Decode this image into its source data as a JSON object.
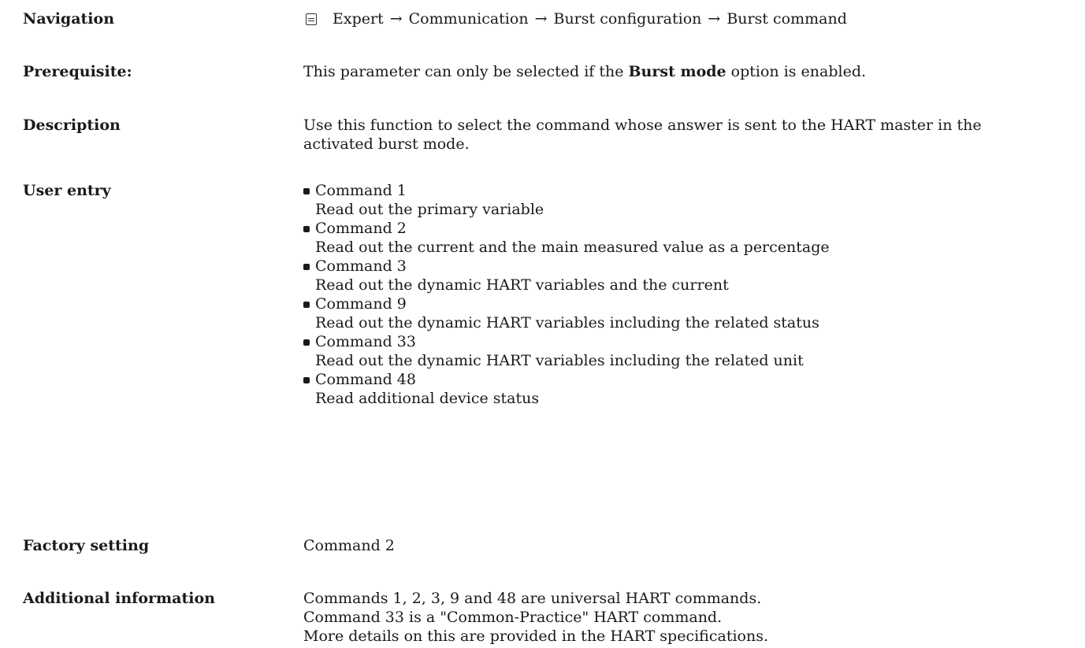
{
  "navigation": {
    "label": "Navigation",
    "icon": "menu-icon",
    "path": [
      "Expert",
      "Communication",
      "Burst configuration",
      "Burst command"
    ],
    "separator": "→"
  },
  "prerequisite": {
    "label": "Prerequisite:",
    "text_before": "This parameter can only be selected if the ",
    "bold": "Burst mode",
    "text_after": " option is enabled."
  },
  "description": {
    "label": "Description",
    "line1": "Use this function to select the command whose answer is sent to the HART master in the",
    "line2": "activated burst mode."
  },
  "user_entry": {
    "label": "User entry",
    "items": [
      {
        "name": "Command 1",
        "desc": "Read out the primary variable"
      },
      {
        "name": "Command 2",
        "desc": "Read out the current and the main measured value as a percentage"
      },
      {
        "name": "Command 3",
        "desc": "Read out the dynamic HART variables and the current"
      },
      {
        "name": "Command 9",
        "desc": "Read out the dynamic HART variables including the related status"
      },
      {
        "name": "Command 33",
        "desc": "Read out the dynamic HART variables including the related unit"
      },
      {
        "name": "Command 48",
        "desc": "Read additional device status"
      }
    ]
  },
  "factory_setting": {
    "label": "Factory setting",
    "value": "Command 2"
  },
  "additional_information": {
    "label": "Additional information",
    "lines": [
      "Commands 1, 2, 3, 9 and 48 are universal HART commands.",
      "Command 33 is a \"Common-Practice\" HART command.",
      "More details on this are provided in the HART specifications."
    ]
  }
}
